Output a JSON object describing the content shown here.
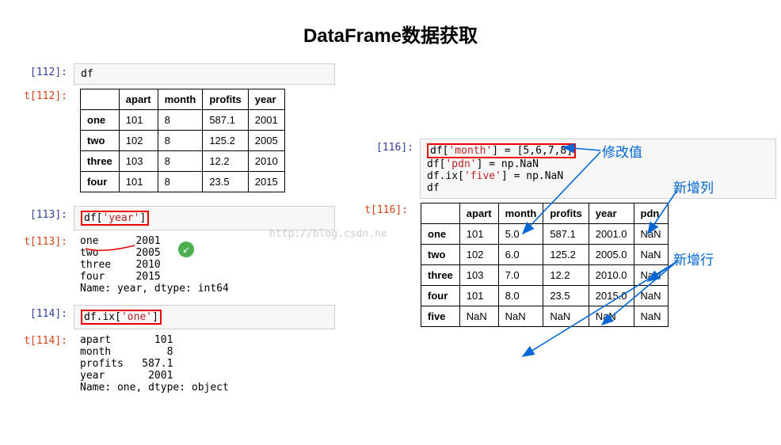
{
  "title": "DataFrame数据获取",
  "watermark": "http://blog.csdn.ne",
  "cells": {
    "c112": {
      "in": "[112]:",
      "out": "[112]:",
      "out_prefix": "t",
      "code": "df"
    },
    "c113": {
      "in": "[113]:",
      "out": "[113]:",
      "out_prefix": "t",
      "code_pre": "df[",
      "code_str": "'year'",
      "code_post": "]",
      "output": "one      2001\ntwo      2005\nthree    2010\nfour     2015\nName: year, dtype: int64"
    },
    "c114": {
      "in": "[114]:",
      "out": "[114]:",
      "out_prefix": "t",
      "code_pre": "df.ix[",
      "code_str": "'one'",
      "code_post": "]",
      "output": "apart       101\nmonth         8\nprofits   587.1\nyear       2001\nName: one, dtype: object"
    },
    "c116": {
      "in": "[116]:",
      "out": "[116]:",
      "out_prefix": "t",
      "lines": [
        {
          "pre": "df[",
          "str": "'month'",
          "post": "] = [5,6,7,8]",
          "red": true
        },
        {
          "pre": "df[",
          "str": "'pdn'",
          "post": "] = np.NaN"
        },
        {
          "pre": "df.ix[",
          "str": "'five'",
          "post": "] = np.NaN"
        },
        {
          "pre": "df",
          "str": "",
          "post": ""
        }
      ]
    }
  },
  "table1": {
    "headers": [
      "",
      "apart",
      "month",
      "profits",
      "year"
    ],
    "rows": [
      [
        "one",
        "101",
        "8",
        "587.1",
        "2001"
      ],
      [
        "two",
        "102",
        "8",
        "125.2",
        "2005"
      ],
      [
        "three",
        "103",
        "8",
        "12.2",
        "2010"
      ],
      [
        "four",
        "101",
        "8",
        "23.5",
        "2015"
      ]
    ]
  },
  "table2": {
    "headers": [
      "",
      "apart",
      "month",
      "profits",
      "year",
      "pdn"
    ],
    "rows": [
      [
        "one",
        "101",
        "5.0",
        "587.1",
        "2001.0",
        "NaN"
      ],
      [
        "two",
        "102",
        "6.0",
        "125.2",
        "2005.0",
        "NaN"
      ],
      [
        "three",
        "103",
        "7.0",
        "12.2",
        "2010.0",
        "NaN"
      ],
      [
        "four",
        "101",
        "8.0",
        "23.5",
        "2015.0",
        "NaN"
      ],
      [
        "five",
        "NaN",
        "NaN",
        "NaN",
        "NaN",
        "NaN"
      ]
    ]
  },
  "annotations": {
    "a1": "修改值",
    "a2": "新增列",
    "a3": "新增行"
  }
}
